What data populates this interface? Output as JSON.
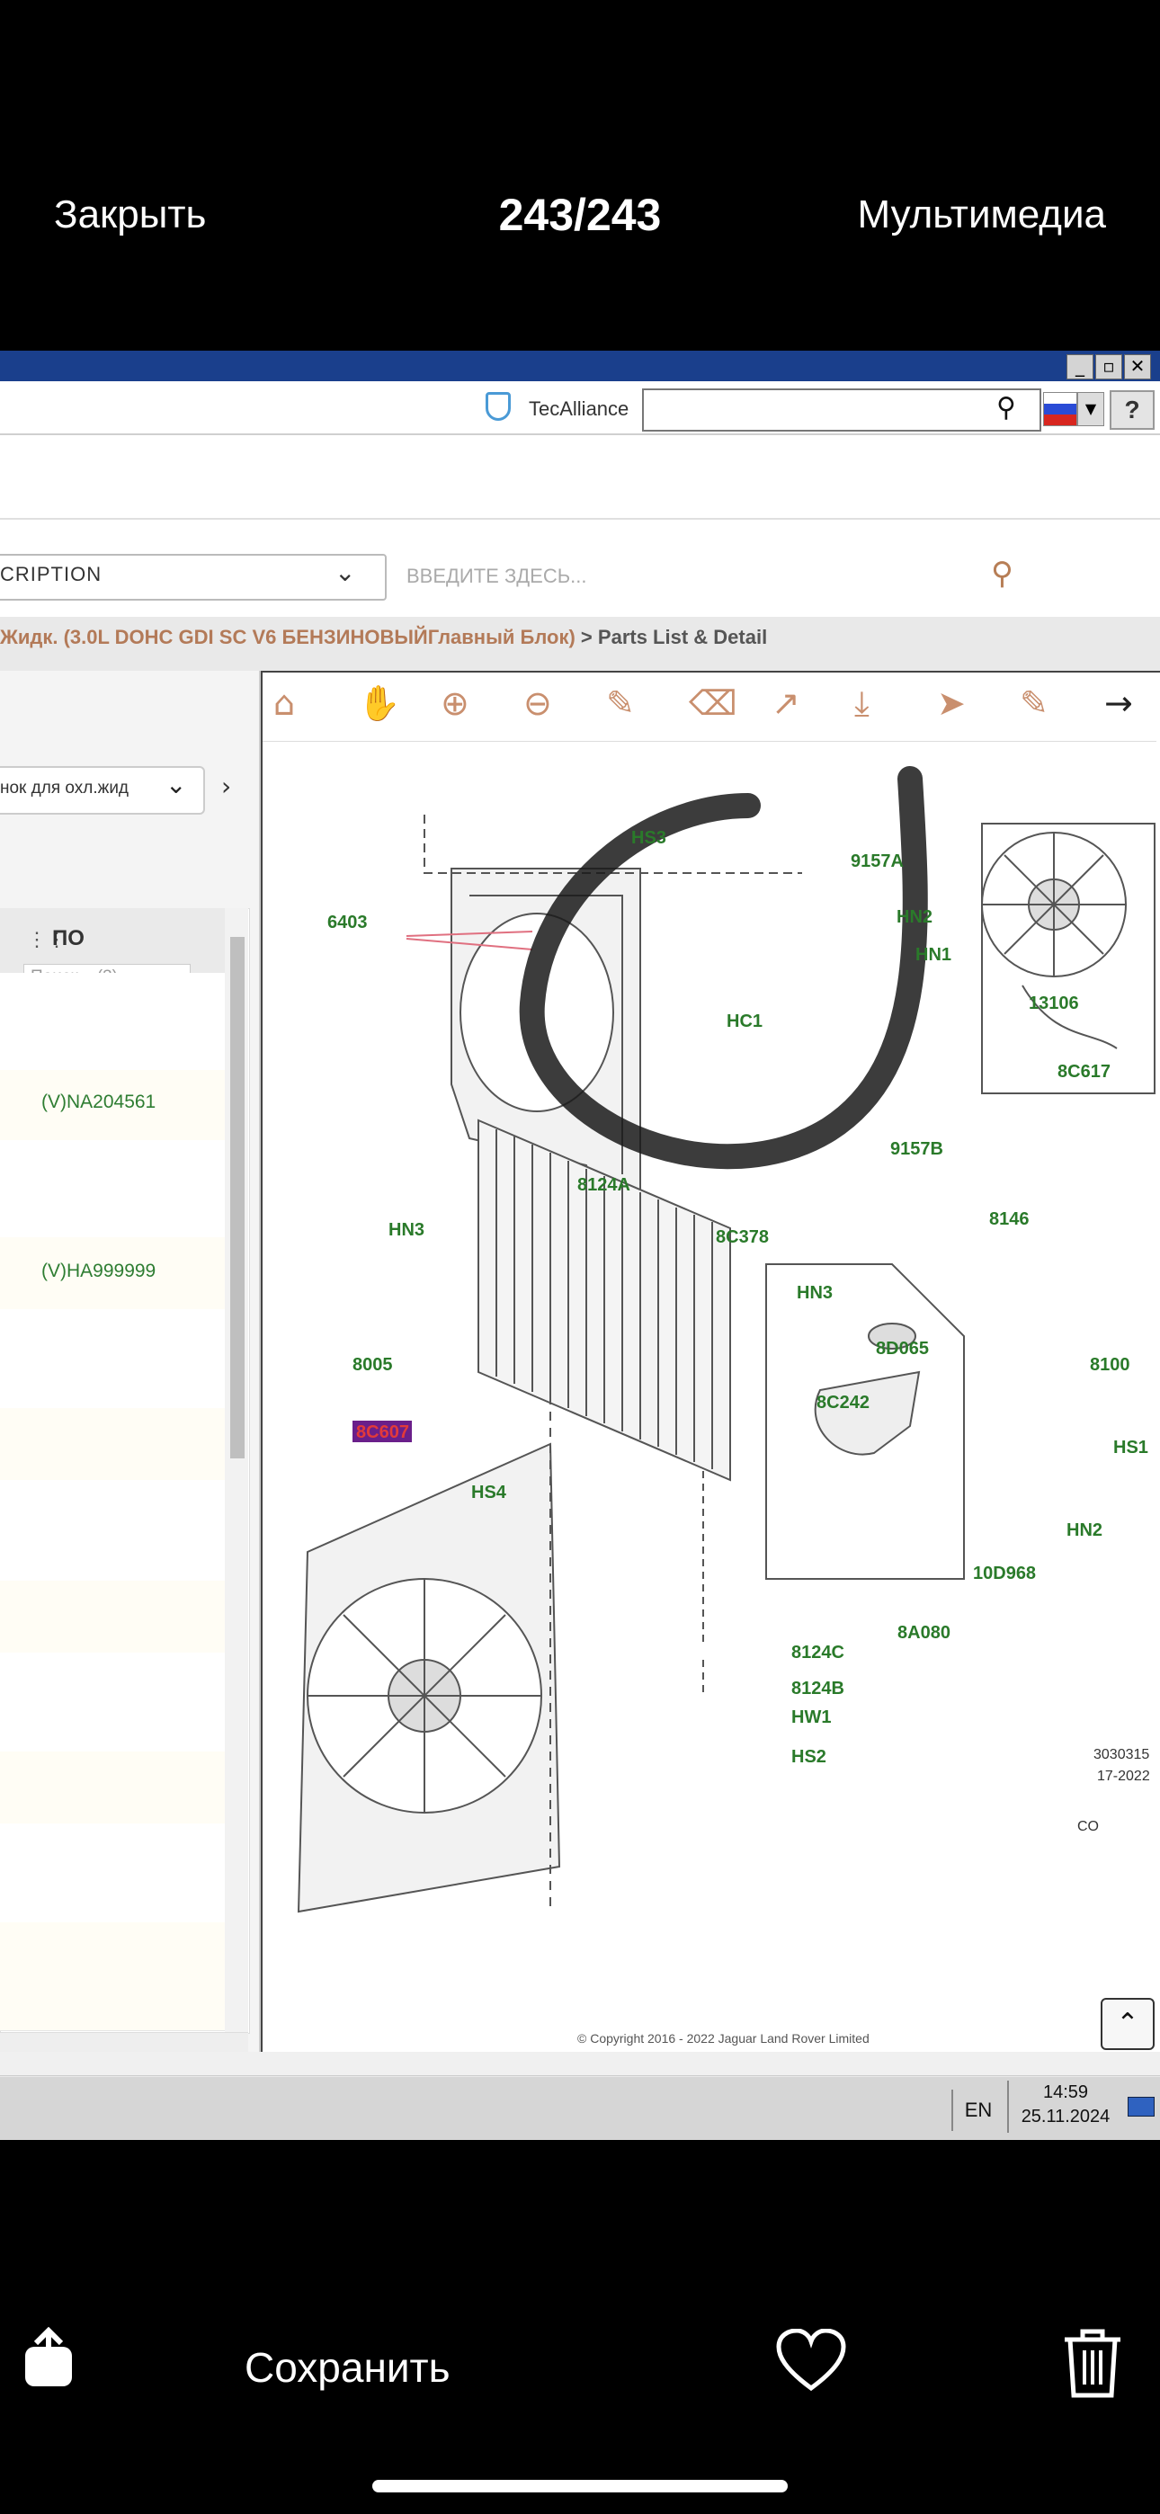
{
  "viewer": {
    "close_label": "Закрыть",
    "counter": "243/243",
    "media_label": "Мультимедиа",
    "save_label": "Сохранить"
  },
  "window": {
    "buttons": [
      "_",
      "▫",
      "✕"
    ]
  },
  "header": {
    "brand": "TecAlliance",
    "search_value": "",
    "help": "?"
  },
  "filter": {
    "select_value": "CRIPTION",
    "search_placeholder": "ВВЕДИТЕ ЗДЕСЬ..."
  },
  "breadcrumb": {
    "part1": "Жидк. (3.0L DOHC GDI SC V6 БЕНЗИНОВЫЙ",
    "part2": "Главный Блок)",
    "separator": ">",
    "current": "Parts List & Detail"
  },
  "left_panel": {
    "subselect": "нок для охл.жид",
    "column_header": "ПО",
    "column_filter_placeholder": "Поиск... (3)",
    "rows": [
      "",
      "(V)NA204561",
      "",
      "(V)HA999999",
      "",
      "",
      "",
      "",
      "",
      "",
      "",
      ""
    ]
  },
  "diagram": {
    "labels": [
      "HS3",
      "9157A",
      "HN2",
      "HN1",
      "6403",
      "HC1",
      "13106",
      "8C617",
      "9157B",
      "8146",
      "8124A",
      "HN3",
      "8C378",
      "HN3",
      "8005",
      "8D065",
      "8100",
      "8C242",
      "HS1",
      "8C607",
      "HS4",
      "HN2",
      "10D968",
      "8A080",
      "8124C",
      "8124B",
      "HW1",
      "HS2",
      "3030315",
      "17-2022",
      "CO"
    ],
    "highlighted_label": "8C607",
    "footer_partial": "© Copyright 2016 - 2022 Jaguar Land Rover Limited"
  },
  "taskbar": {
    "lang": "EN",
    "time": "14:59",
    "date": "25.11.2024"
  }
}
